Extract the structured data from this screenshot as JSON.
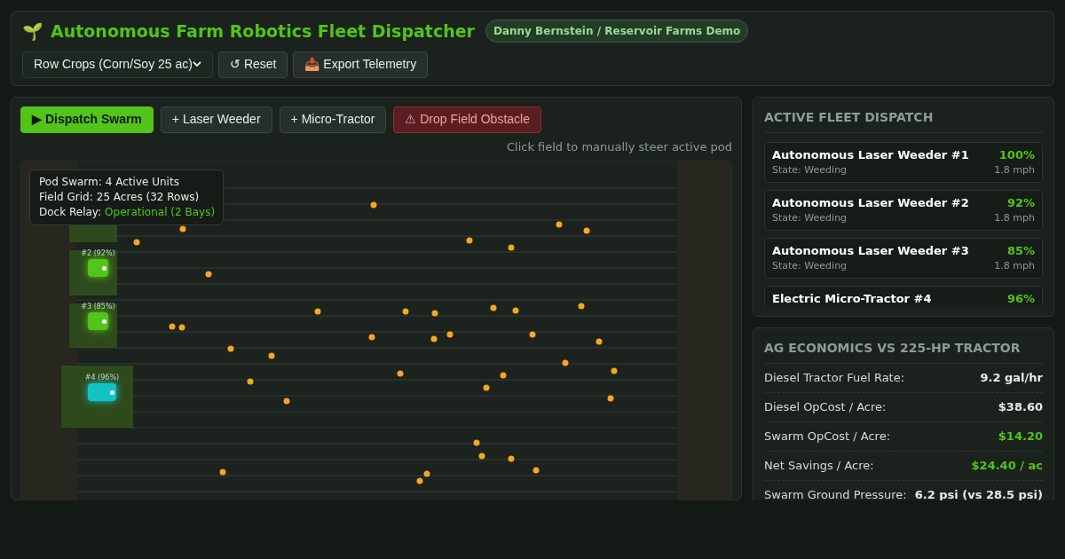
{
  "header": {
    "icon": "🌱",
    "title": "Autonomous Farm Robotics Fleet Dispatcher",
    "badge": "Danny Bernstein / Reservoir Farms Demo",
    "field_select": "Row Crops (Corn/Soy 25 ac)",
    "buttons": [
      {
        "icon": "↺",
        "label": "Reset"
      },
      {
        "icon": "📥",
        "label": "Export Telemetry"
      }
    ]
  },
  "toolbar": {
    "buttons": [
      {
        "kind": "primary",
        "label": "▶ Dispatch Swarm"
      },
      {
        "kind": "default",
        "label": "+ Laser Weeder"
      },
      {
        "kind": "default",
        "label": "+ Micro-Tractor"
      },
      {
        "kind": "danger",
        "label": "⚠ Drop Field Obstacle"
      }
    ],
    "hint": "Click field to manually steer active pod"
  },
  "field": {
    "overlay": [
      {
        "label": "Pod Swarm:",
        "value": "4 Active Units",
        "highlight": false
      },
      {
        "label": "Field Grid:",
        "value": "25 Acres (32 Rows)",
        "highlight": false
      },
      {
        "label": "Dock Relay:",
        "value": "Operational (2 Bays)",
        "highlight": true
      }
    ],
    "pods": [
      {
        "label": "#2 (92%)",
        "kind": "weeder",
        "color": "#52c41a"
      },
      {
        "label": "#3 (85%)",
        "kind": "weeder",
        "color": "#52c41a"
      },
      {
        "label": "#4 (96%)",
        "kind": "tractor",
        "color": "#13c2c2"
      }
    ]
  },
  "fleet": {
    "title": "ACTIVE FLEET DISPATCH",
    "units": [
      {
        "name": "Autonomous Laser Weeder #1",
        "battery": "100%",
        "state": "State: Weeding",
        "speed": "1.8 mph"
      },
      {
        "name": "Autonomous Laser Weeder #2",
        "battery": "92%",
        "state": "State: Weeding",
        "speed": "1.8 mph"
      },
      {
        "name": "Autonomous Laser Weeder #3",
        "battery": "85%",
        "state": "State: Weeding",
        "speed": "1.8 mph"
      },
      {
        "name": "Electric Micro-Tractor #4",
        "battery": "96%"
      }
    ]
  },
  "economics": {
    "title": "AG ECONOMICS VS 225-HP TRACTOR",
    "rows": [
      {
        "label": "Diesel Tractor Fuel Rate:",
        "value": "9.2 gal/hr",
        "highlight": false
      },
      {
        "label": "Diesel OpCost / Acre:",
        "value": "$38.60",
        "highlight": false
      },
      {
        "label": "Swarm OpCost / Acre:",
        "value": "$14.20",
        "highlight": true
      },
      {
        "label": "Net Savings / Acre:",
        "value": "$24.40 / ac",
        "highlight": true
      },
      {
        "label": "Swarm Ground Pressure:",
        "value": "6.2 psi (vs 28.5 psi)",
        "highlight": false
      }
    ]
  }
}
